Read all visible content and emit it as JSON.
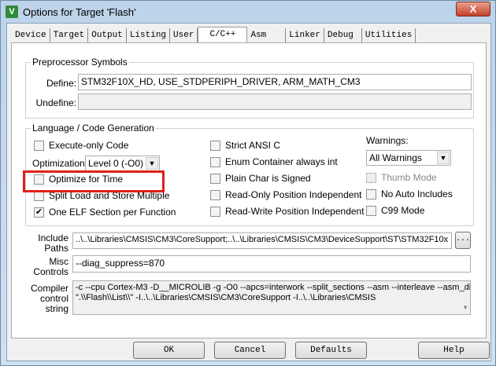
{
  "window": {
    "title": "Options for Target 'Flash'",
    "close": "X",
    "icon": "V"
  },
  "tabs": [
    "Device",
    "Target",
    "Output",
    "Listing",
    "User",
    "C/C++",
    "Asm",
    "Linker",
    "Debug",
    "Utilities"
  ],
  "preprocessor": {
    "title": "Preprocessor Symbols",
    "define_label": "Define:",
    "define_value": "STM32F10X_HD, USE_STDPERIPH_DRIVER, ARM_MATH_CM3",
    "undefine_label": "Undefine:",
    "undefine_value": ""
  },
  "language": {
    "title": "Language / Code Generation",
    "col1": [
      {
        "label": "Execute-only Code",
        "checked": false
      },
      {
        "label": "Optimize for Time",
        "checked": false
      },
      {
        "label": "Split Load and Store Multiple",
        "checked": false
      },
      {
        "label": "One ELF Section per Function",
        "checked": true
      }
    ],
    "optimization_label": "Optimization:",
    "optimization_value": "Level 0 (-O0)",
    "col2": [
      {
        "label": "Strict ANSI C",
        "checked": false
      },
      {
        "label": "Enum Container always int",
        "checked": false
      },
      {
        "label": "Plain Char is Signed",
        "checked": false
      },
      {
        "label": "Read-Only Position Independent",
        "checked": false
      },
      {
        "label": "Read-Write Position Independent",
        "checked": false
      }
    ],
    "warnings_label": "Warnings:",
    "warnings_value": "All Warnings",
    "col3": [
      {
        "label": "Thumb Mode",
        "checked": false,
        "disabled": true
      },
      {
        "label": "No Auto Includes",
        "checked": false
      },
      {
        "label": "C99 Mode",
        "checked": false
      }
    ]
  },
  "include": {
    "label1": "Include",
    "label2": "Paths",
    "value": "..\\..\\Libraries\\CMSIS\\CM3\\CoreSupport;..\\..\\Libraries\\CMSIS\\CM3\\DeviceSupport\\ST\\STM32F10x",
    "browse": "..."
  },
  "misc": {
    "label1": "Misc",
    "label2": "Controls",
    "value": "--diag_suppress=870"
  },
  "compiler": {
    "label1": "Compiler",
    "label2": "control",
    "label3": "string",
    "line1": "-c --cpu Cortex-M3 -D__MICROLIB -g -O0 --apcs=interwork --split_sections --asm --interleave --asm_dir",
    "line2": "\".\\\\Flash\\\\List\\\\\" -I..\\..\\Libraries\\CMSIS\\CM3\\CoreSupport -I..\\..\\Libraries\\CMSIS"
  },
  "buttons": {
    "ok": "OK",
    "cancel": "Cancel",
    "defaults": "Defaults",
    "help": "Help"
  }
}
